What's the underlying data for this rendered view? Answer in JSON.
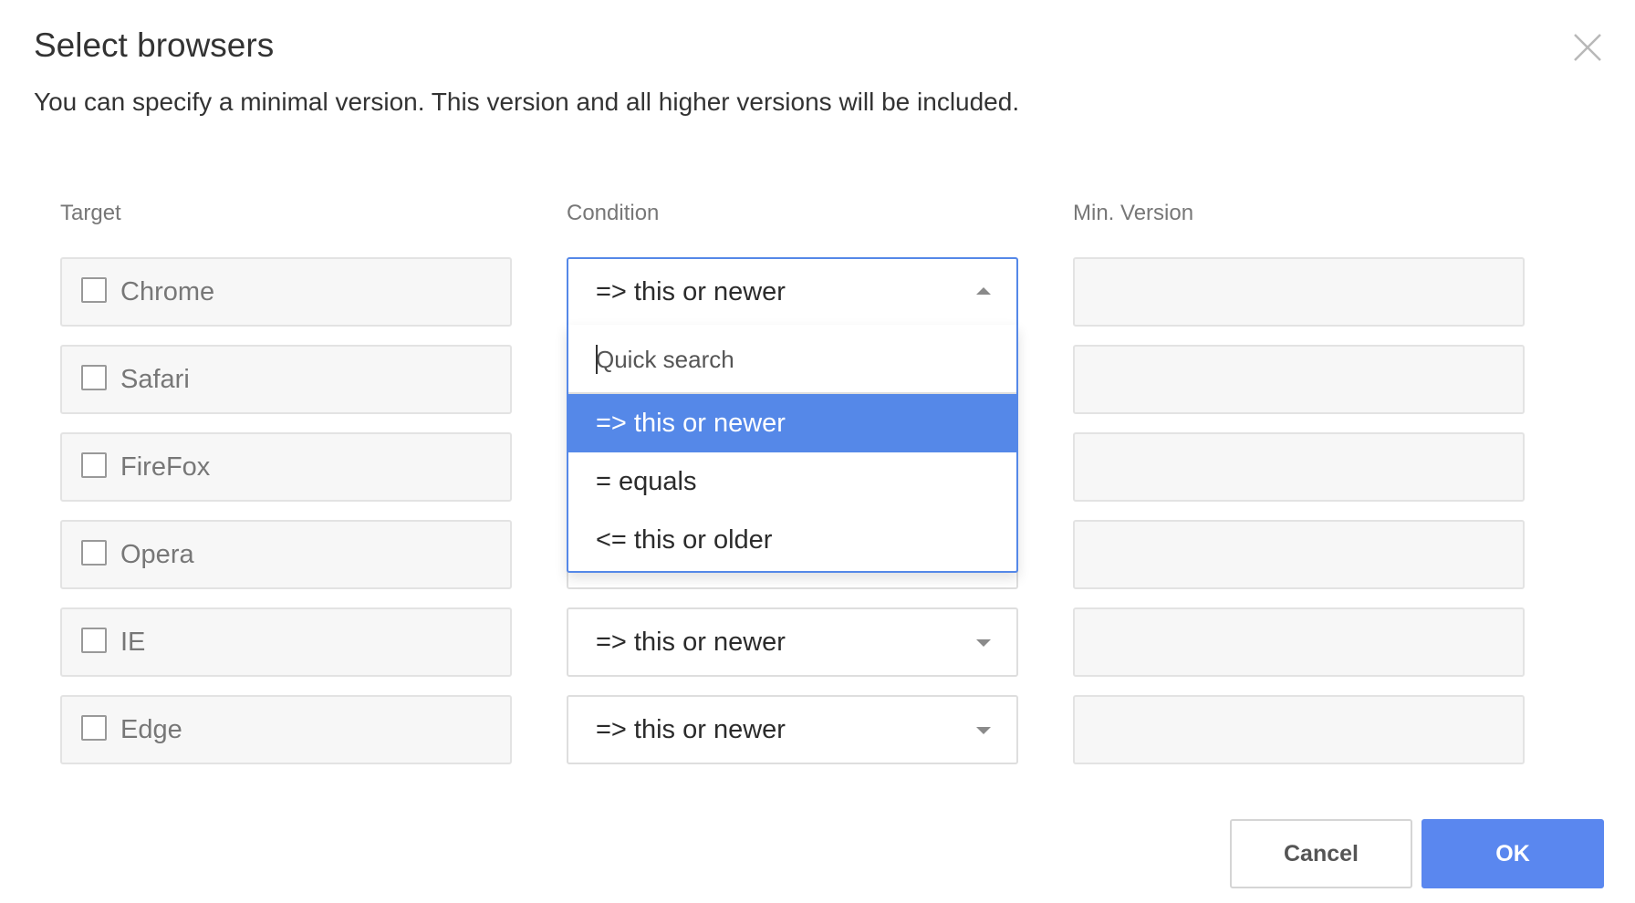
{
  "dialog": {
    "title": "Select browsers",
    "subtitle": "You can specify a minimal version. This version and all higher versions will be included.",
    "close_icon": "close-icon"
  },
  "columns": {
    "target": "Target",
    "condition": "Condition",
    "min_version": "Min. Version"
  },
  "rows": [
    {
      "browser": "Chrome",
      "checked": false,
      "condition": "=> this or newer",
      "min_version": ""
    },
    {
      "browser": "Safari",
      "checked": false,
      "condition": "",
      "min_version": ""
    },
    {
      "browser": "FireFox",
      "checked": false,
      "condition": "",
      "min_version": ""
    },
    {
      "browser": "Opera",
      "checked": false,
      "condition": "",
      "min_version": ""
    },
    {
      "browser": "IE",
      "checked": false,
      "condition": "=> this or newer",
      "min_version": ""
    },
    {
      "browser": "Edge",
      "checked": false,
      "condition": "=> this or newer",
      "min_version": ""
    }
  ],
  "dropdown": {
    "open_row": "Chrome",
    "search_placeholder": "Quick search",
    "options": [
      {
        "label": "=> this or newer",
        "selected": true
      },
      {
        "label": "= equals",
        "selected": false
      },
      {
        "label": "<= this or older",
        "selected": false
      }
    ]
  },
  "buttons": {
    "cancel": "Cancel",
    "ok": "OK"
  },
  "colors": {
    "accent": "#5588e8",
    "ok_button": "#5a87ef"
  }
}
